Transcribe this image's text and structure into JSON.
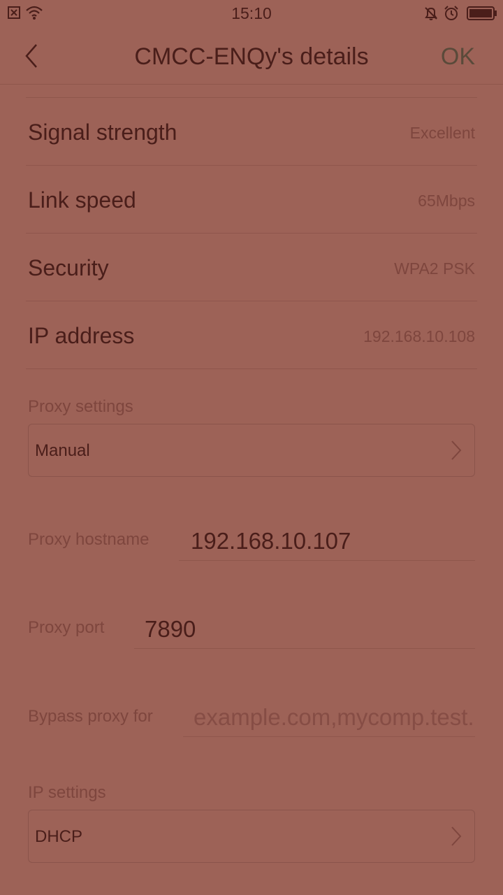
{
  "status_bar": {
    "time": "15:10"
  },
  "header": {
    "title": "CMCC-ENQy's details",
    "ok_label": "OK"
  },
  "info_rows": [
    {
      "label": "Signal strength",
      "value": "Excellent"
    },
    {
      "label": "Link speed",
      "value": "65Mbps"
    },
    {
      "label": "Security",
      "value": "WPA2 PSK"
    },
    {
      "label": "IP address",
      "value": "192.168.10.108"
    }
  ],
  "proxy": {
    "section_label": "Proxy settings",
    "selected": "Manual",
    "hostname_label": "Proxy hostname",
    "hostname_value": "192.168.10.107",
    "port_label": "Proxy port",
    "port_value": "7890",
    "bypass_label": "Bypass proxy for",
    "bypass_placeholder": "example.com,mycomp.test.com"
  },
  "ip_settings": {
    "section_label": "IP settings",
    "selected": "DHCP"
  },
  "colors": {
    "background": "#9d6257",
    "text": "#4a1e1a",
    "secondary_text": "#7e463e"
  }
}
